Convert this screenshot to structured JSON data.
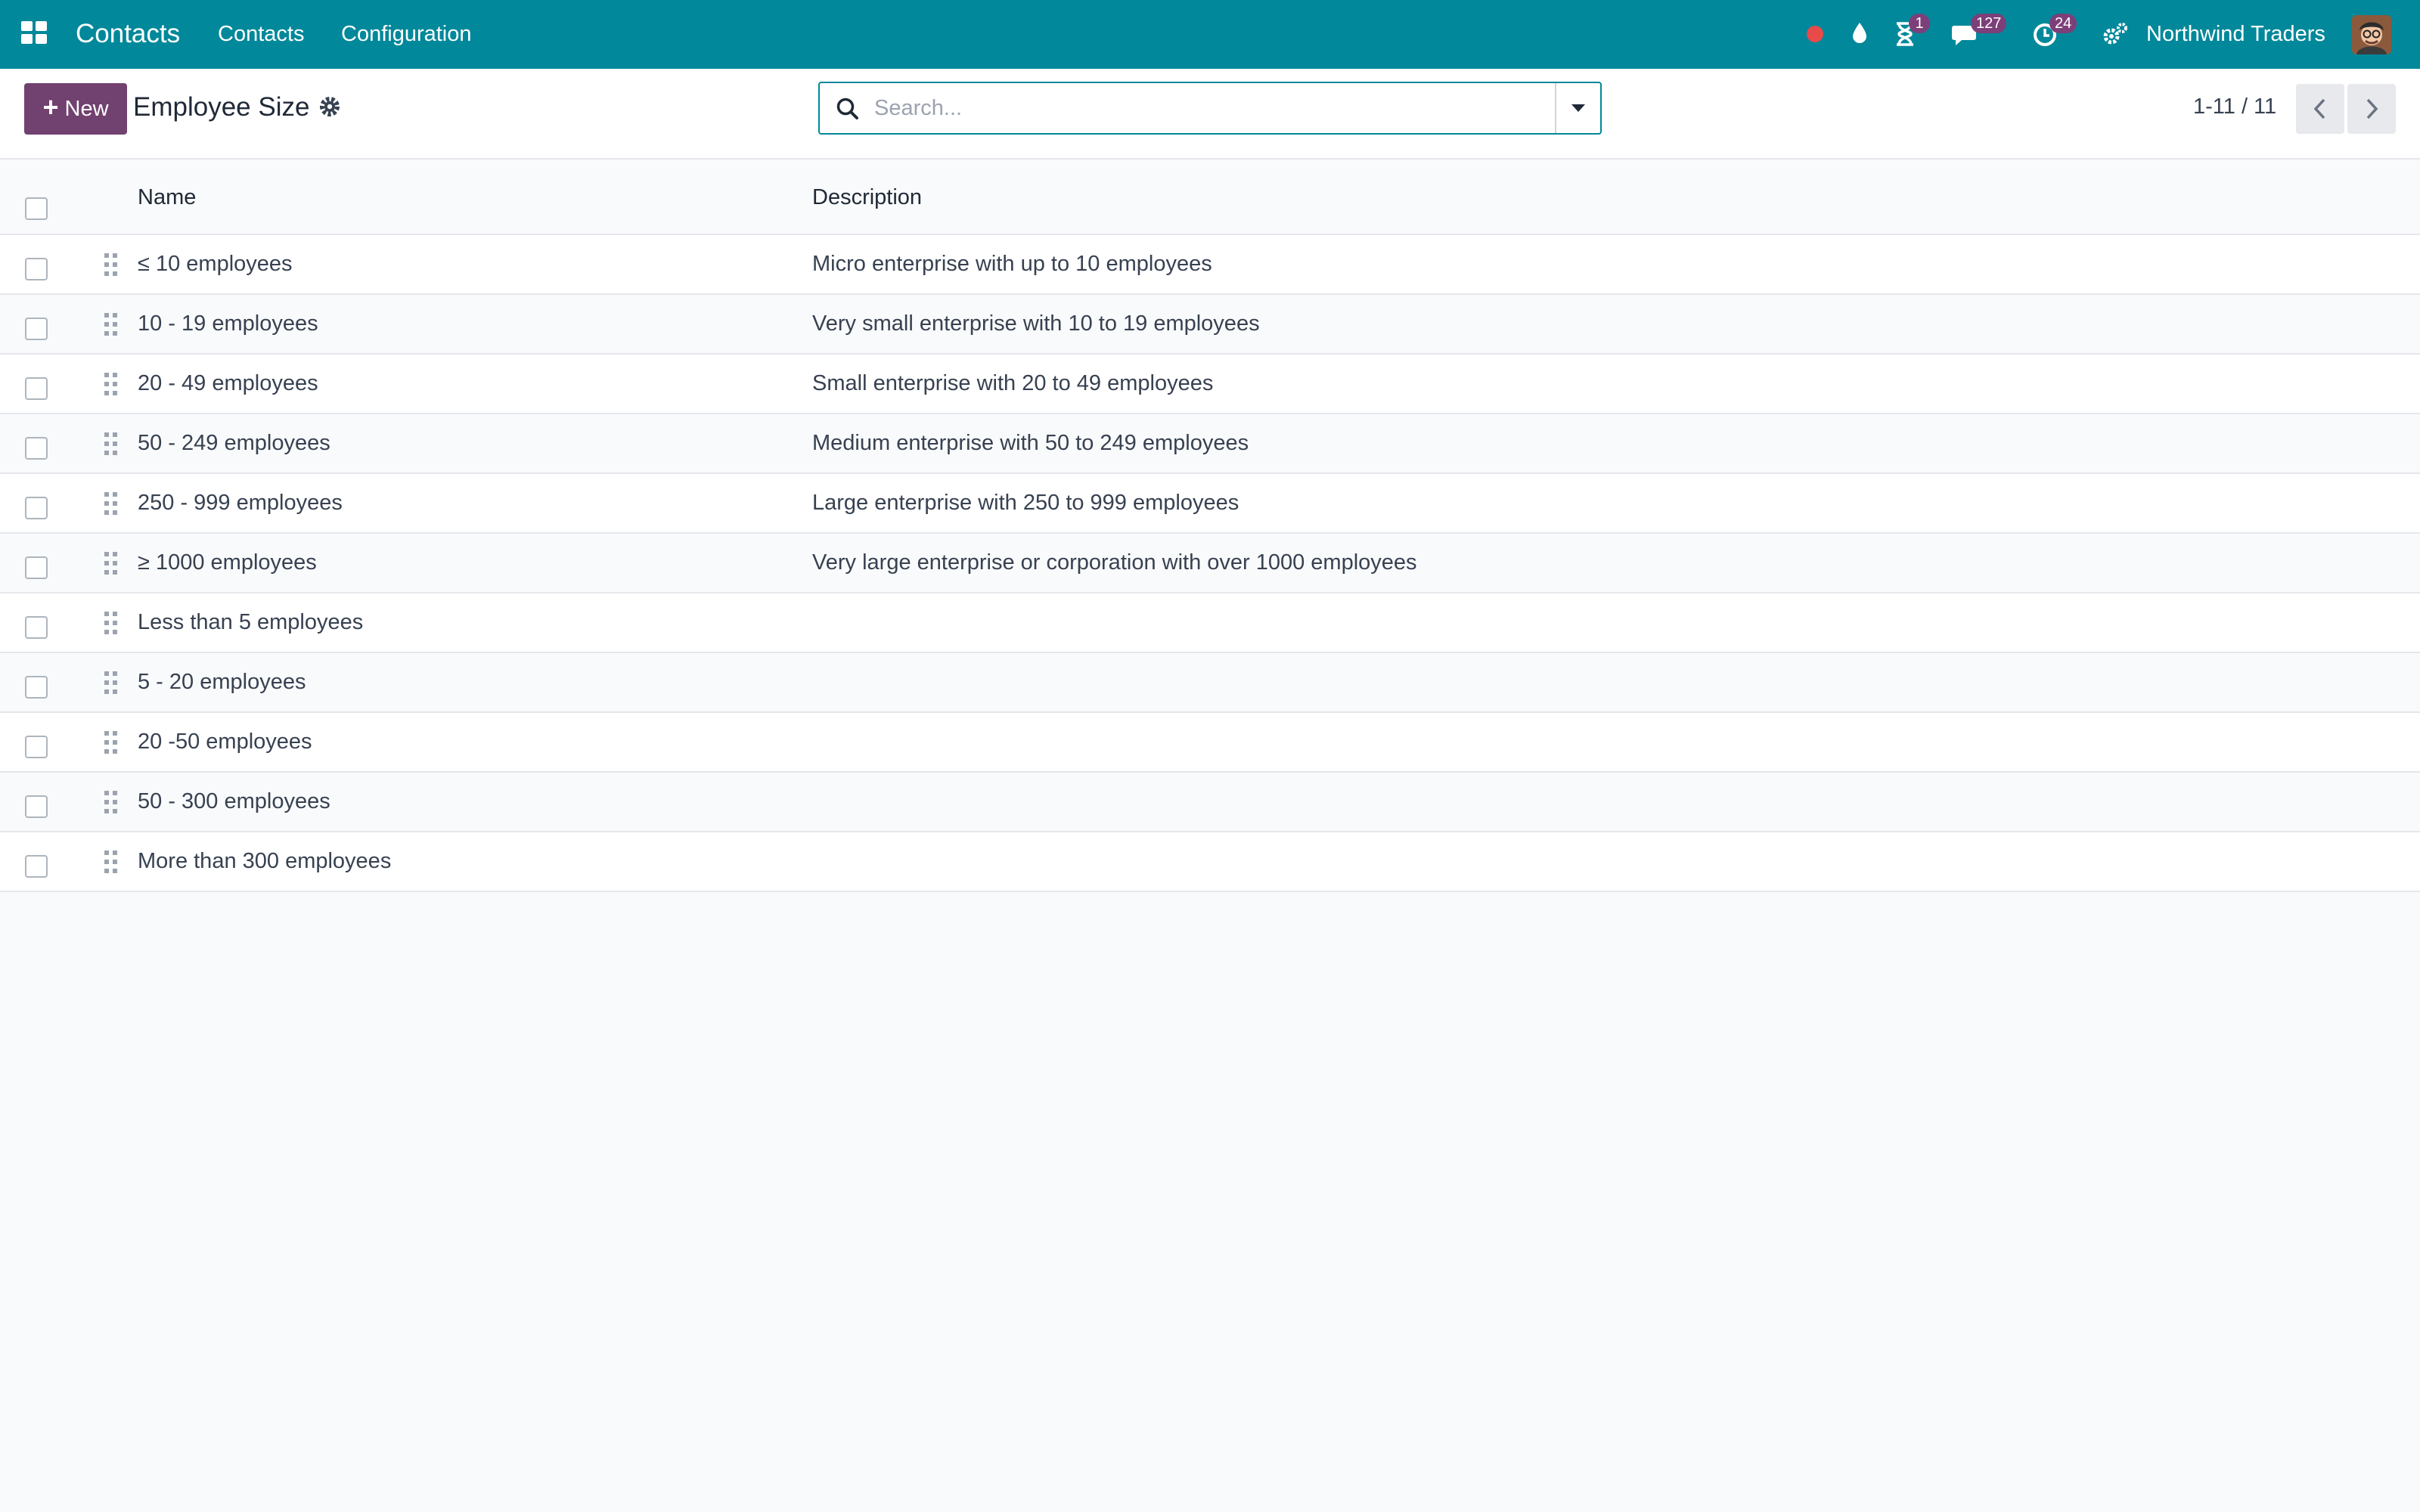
{
  "navbar": {
    "app_name": "Contacts",
    "menu": [
      "Contacts",
      "Configuration"
    ],
    "badges": {
      "activities": "1",
      "messages": "127",
      "timer": "24"
    },
    "company": "Northwind Traders",
    "colors": {
      "bar": "#01889a",
      "badge": "#7c3f79",
      "recording": "#e84a4a"
    }
  },
  "control": {
    "new_label": "New",
    "title": "Employee Size",
    "search_placeholder": "Search...",
    "pager": "1-11 / 11"
  },
  "table": {
    "columns": [
      "Name",
      "Description"
    ],
    "rows": [
      {
        "name": "≤ 10 employees",
        "description": "Micro enterprise with up to 10 employees"
      },
      {
        "name": "10 - 19 employees",
        "description": "Very small enterprise with 10 to 19 employees"
      },
      {
        "name": "20 - 49 employees",
        "description": "Small enterprise with 20 to 49 employees"
      },
      {
        "name": "50 - 249 employees",
        "description": "Medium enterprise with 50 to 249 employees"
      },
      {
        "name": "250 - 999 employees",
        "description": "Large enterprise with 250 to 999 employees"
      },
      {
        "name": "≥ 1000 employees",
        "description": "Very large enterprise or corporation with over 1000 employees"
      },
      {
        "name": "Less than 5 employees",
        "description": ""
      },
      {
        "name": "5 - 20 employees",
        "description": ""
      },
      {
        "name": "20 -50 employees",
        "description": ""
      },
      {
        "name": "50 - 300 employees",
        "description": ""
      },
      {
        "name": "More than 300 employees",
        "description": ""
      }
    ]
  }
}
